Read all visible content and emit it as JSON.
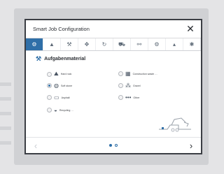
{
  "dialog": {
    "title": "Smart Job Configuration",
    "close_icon": "close-icon",
    "close_glyph": "✕"
  },
  "tabs": [
    {
      "icon": "material-icon",
      "glyph": "⚙",
      "active": true
    },
    {
      "icon": "mountain-icon",
      "glyph": "▲",
      "active": false
    },
    {
      "icon": "shovel-icon",
      "glyph": "⚒",
      "active": false
    },
    {
      "icon": "compass-icon",
      "glyph": "✥",
      "active": false
    },
    {
      "icon": "rotate-icon",
      "glyph": "↻",
      "active": false
    },
    {
      "icon": "machine-icon",
      "glyph": "⛟",
      "active": false
    },
    {
      "icon": "link-icon",
      "glyph": "⚯",
      "active": false
    },
    {
      "icon": "tools-icon",
      "glyph": "⚙",
      "active": false
    },
    {
      "icon": "cone-icon",
      "glyph": "▴",
      "active": false
    },
    {
      "icon": "settings-icon",
      "glyph": "✱",
      "active": false
    }
  ],
  "section": {
    "title": "Aufgabenmaterial",
    "icon": "material-icon",
    "glyph": "⚒"
  },
  "options": [
    {
      "label": "Hard rock",
      "icon": "rock-icon",
      "glyph": "⛰",
      "selected": false
    },
    {
      "label": "Construction waste …",
      "icon": "construction-waste-icon",
      "glyph": "▦",
      "selected": false
    },
    {
      "label": "Soft stone",
      "icon": "soft-stone-icon",
      "glyph": "◍",
      "selected": true
    },
    {
      "label": "Gravel",
      "icon": "gravel-icon",
      "glyph": "⁂",
      "selected": false
    },
    {
      "label": "Asphalt",
      "icon": "asphalt-icon",
      "glyph": "▭",
      "selected": false
    },
    {
      "label": "Other",
      "icon": "other-icon",
      "glyph": "•••",
      "selected": false
    },
    {
      "label": "Recycling …",
      "icon": "recycling-icon",
      "glyph": "◒",
      "selected": false
    }
  ],
  "pagination": {
    "prev_glyph": "‹",
    "next_glyph": "›",
    "pages": 2,
    "current": 1
  },
  "colors": {
    "accent": "#2f6fa8",
    "text": "#2b2e33",
    "background": "#e4e4e6"
  }
}
